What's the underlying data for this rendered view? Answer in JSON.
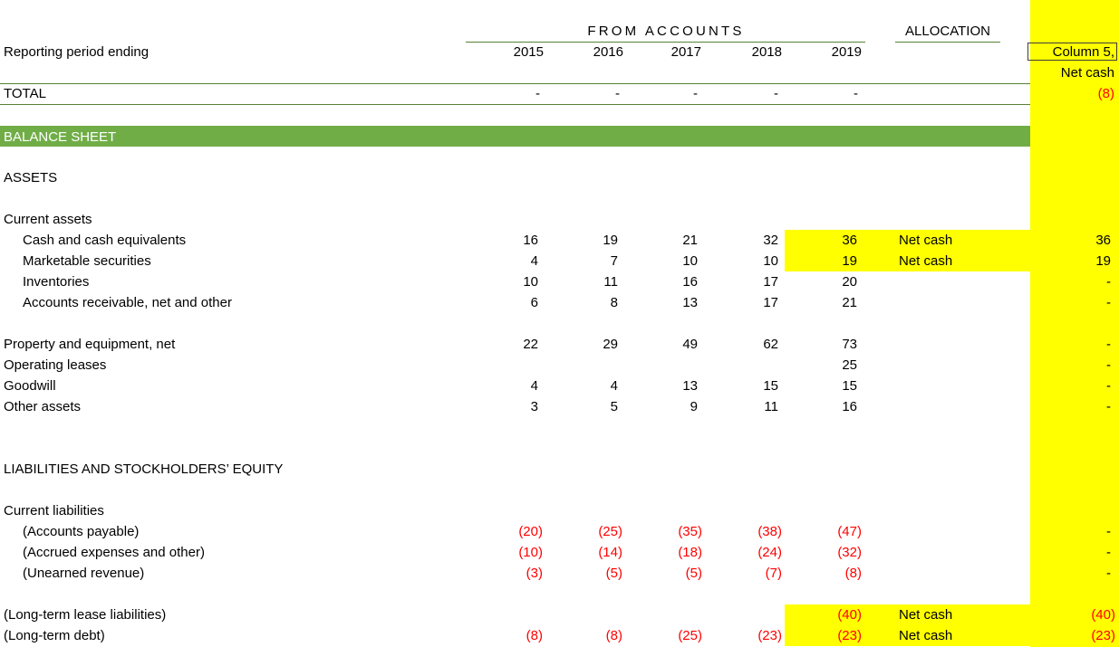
{
  "header": {
    "from_accounts": "FROM ACCOUNTS",
    "allocation": "ALLOCATION",
    "period_label": "Reporting period ending",
    "years": [
      "2015",
      "2016",
      "2017",
      "2018",
      "2019"
    ],
    "column_title_line1": "Column 5,",
    "column_title_line2": "Net cash"
  },
  "total": {
    "label": "TOTAL",
    "values": [
      "-",
      "-",
      "-",
      "-",
      "-"
    ],
    "column5": "(8)"
  },
  "balance_sheet_label": "BALANCE SHEET",
  "assets_label": "ASSETS",
  "current_assets_label": "Current assets",
  "current_assets": [
    {
      "label": "Cash and cash equivalents",
      "values": [
        "16",
        "19",
        "21",
        "32",
        "36"
      ],
      "allocation": "Net cash",
      "column5": "36"
    },
    {
      "label": "Marketable securities",
      "values": [
        "4",
        "7",
        "10",
        "10",
        "19"
      ],
      "allocation": "Net cash",
      "column5": "19"
    },
    {
      "label": "Inventories",
      "values": [
        "10",
        "11",
        "16",
        "17",
        "20"
      ],
      "allocation": "",
      "column5": "-"
    },
    {
      "label": "Accounts receivable, net and other",
      "values": [
        "6",
        "8",
        "13",
        "17",
        "21"
      ],
      "allocation": "",
      "column5": "-"
    }
  ],
  "other_assets": [
    {
      "label": "Property and equipment, net",
      "values": [
        "22",
        "29",
        "49",
        "62",
        "73"
      ],
      "allocation": "",
      "column5": "-"
    },
    {
      "label": "Operating leases",
      "values": [
        "",
        "",
        "",
        "",
        "25"
      ],
      "allocation": "",
      "column5": "-"
    },
    {
      "label": "Goodwill",
      "values": [
        "4",
        "4",
        "13",
        "15",
        "15"
      ],
      "allocation": "",
      "column5": "-"
    },
    {
      "label": "Other assets",
      "values": [
        "3",
        "5",
        "9",
        "11",
        "16"
      ],
      "allocation": "",
      "column5": "-"
    }
  ],
  "liabilities_label": "LIABILITIES AND STOCKHOLDERS’ EQUITY",
  "current_liabilities_label": "Current liabilities",
  "current_liabilities": [
    {
      "label": "(Accounts payable)",
      "values": [
        "(20)",
        "(25)",
        "(35)",
        "(38)",
        "(47)"
      ],
      "allocation": "",
      "column5": "-"
    },
    {
      "label": "(Accrued expenses and other)",
      "values": [
        "(10)",
        "(14)",
        "(18)",
        "(24)",
        "(32)"
      ],
      "allocation": "",
      "column5": "-"
    },
    {
      "label": "(Unearned revenue)",
      "values": [
        "(3)",
        "(5)",
        "(5)",
        "(7)",
        "(8)"
      ],
      "allocation": "",
      "column5": "-"
    }
  ],
  "long_term": [
    {
      "label": "(Long-term lease liabilities)",
      "values": [
        "",
        "",
        "",
        "",
        "(40)"
      ],
      "allocation": "Net cash",
      "column5": "(40)"
    },
    {
      "label": "(Long-term debt)",
      "values": [
        "(8)",
        "(8)",
        "(25)",
        "(23)",
        "(23)"
      ],
      "allocation": "Net cash",
      "column5": "(23)"
    }
  ],
  "colors": {
    "highlight": "#ffff00",
    "band": "#70ad47",
    "negative": "#ff0000",
    "rule": "#548235"
  }
}
